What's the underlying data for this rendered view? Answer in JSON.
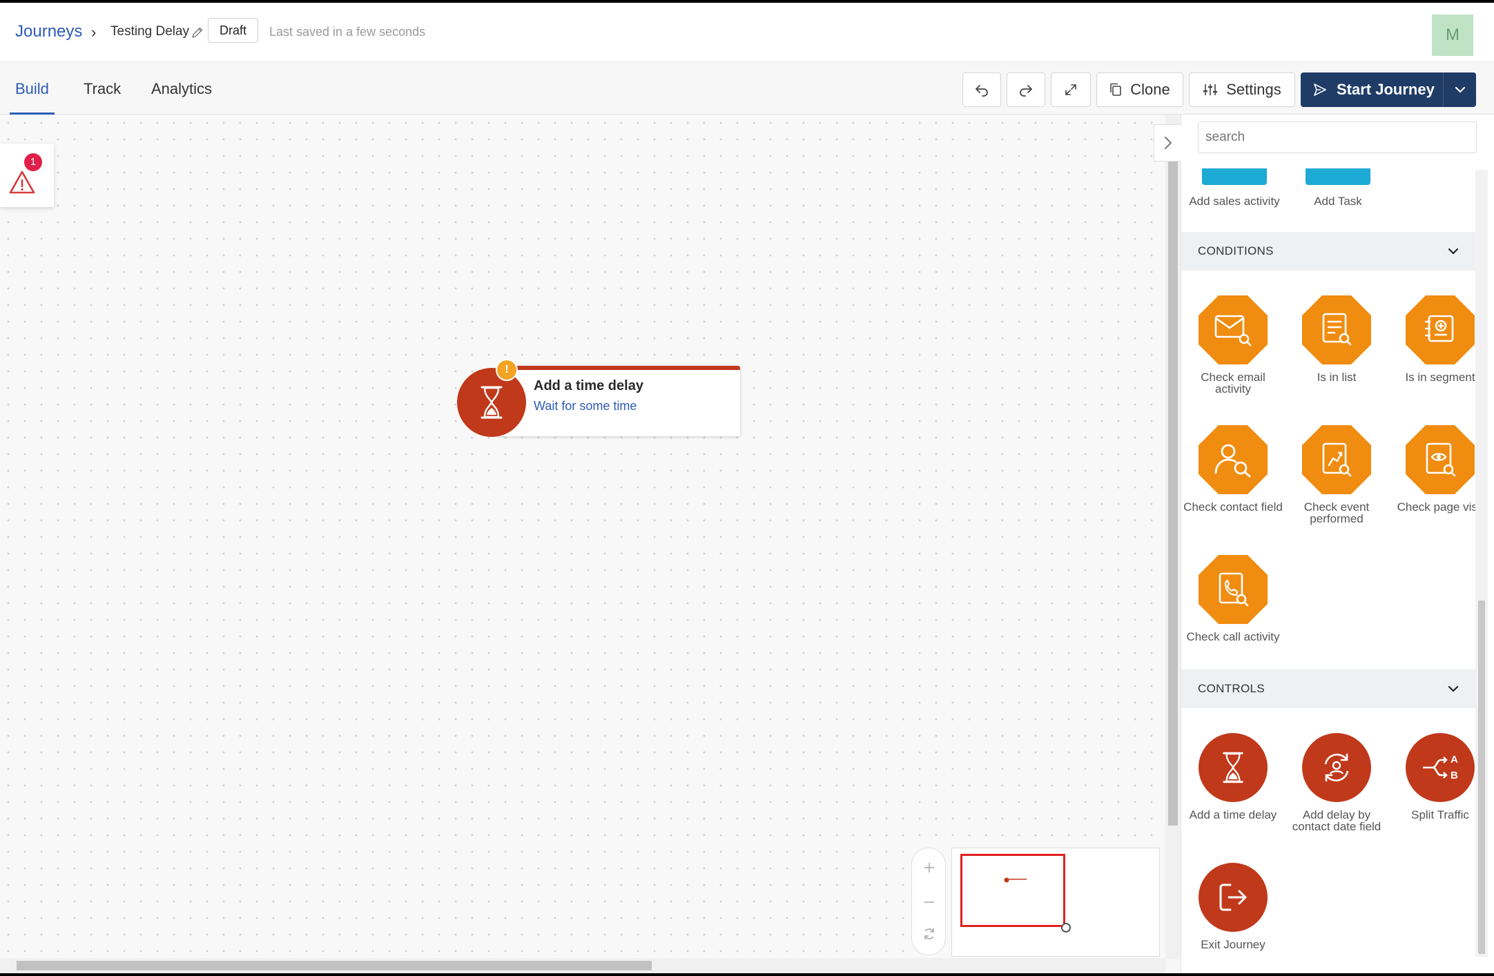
{
  "header": {
    "breadcrumb_root": "Journeys",
    "journey_name": "Testing Delay",
    "status_badge": "Draft",
    "saved_status": "Last saved in a few seconds",
    "avatar_initial": "M"
  },
  "tabs": [
    {
      "label": "Build",
      "active": true
    },
    {
      "label": "Track",
      "active": false
    },
    {
      "label": "Analytics",
      "active": false
    }
  ],
  "toolbar": {
    "undo_icon": "undo-icon",
    "redo_icon": "redo-icon",
    "fullscreen_icon": "expand-icon",
    "clone_label": "Clone",
    "settings_label": "Settings",
    "start_label": "Start Journey"
  },
  "canvas": {
    "warning_count": "1",
    "node": {
      "title": "Add a time delay",
      "subtitle": "Wait for some time",
      "warning_mark": "!"
    }
  },
  "panel": {
    "search_placeholder": "search",
    "actions_partial": [
      {
        "label": "Add sales activity"
      },
      {
        "label": "Add Task"
      }
    ],
    "sections": [
      {
        "title": "CONDITIONS",
        "items": [
          {
            "label_lines": [
              "Check email",
              "activity"
            ],
            "icon": "email-search-icon"
          },
          {
            "label_lines": [
              "Is in list"
            ],
            "icon": "list-search-icon"
          },
          {
            "label_lines": [
              "Is in segment"
            ],
            "icon": "segment-search-icon"
          },
          {
            "label_lines": [
              "Check contact field"
            ],
            "icon": "contact-search-icon"
          },
          {
            "label_lines": [
              "Check event",
              "performed"
            ],
            "icon": "event-search-icon"
          },
          {
            "label_lines": [
              "Check page visit"
            ],
            "icon": "page-visit-icon"
          },
          {
            "label_lines": [
              "Check call activity"
            ],
            "icon": "call-search-icon"
          }
        ]
      },
      {
        "title": "CONTROLS",
        "items": [
          {
            "label_lines": [
              "Add a time delay"
            ],
            "icon": "hourglass-icon"
          },
          {
            "label_lines": [
              "Add delay by",
              "contact date field"
            ],
            "icon": "contact-delay-icon"
          },
          {
            "label_lines": [
              "Split Traffic"
            ],
            "icon": "split-ab-icon"
          },
          {
            "label_lines": [
              "Exit Journey"
            ],
            "icon": "exit-icon"
          }
        ]
      }
    ]
  },
  "colors": {
    "brand_blue": "#2d5bb7",
    "primary_button": "#1f3c66",
    "condition_orange": "#f08c10",
    "control_red": "#c0391b",
    "action_teal": "#1daad4",
    "error_red": "#e0204a",
    "warning_amber": "#f3a323"
  }
}
